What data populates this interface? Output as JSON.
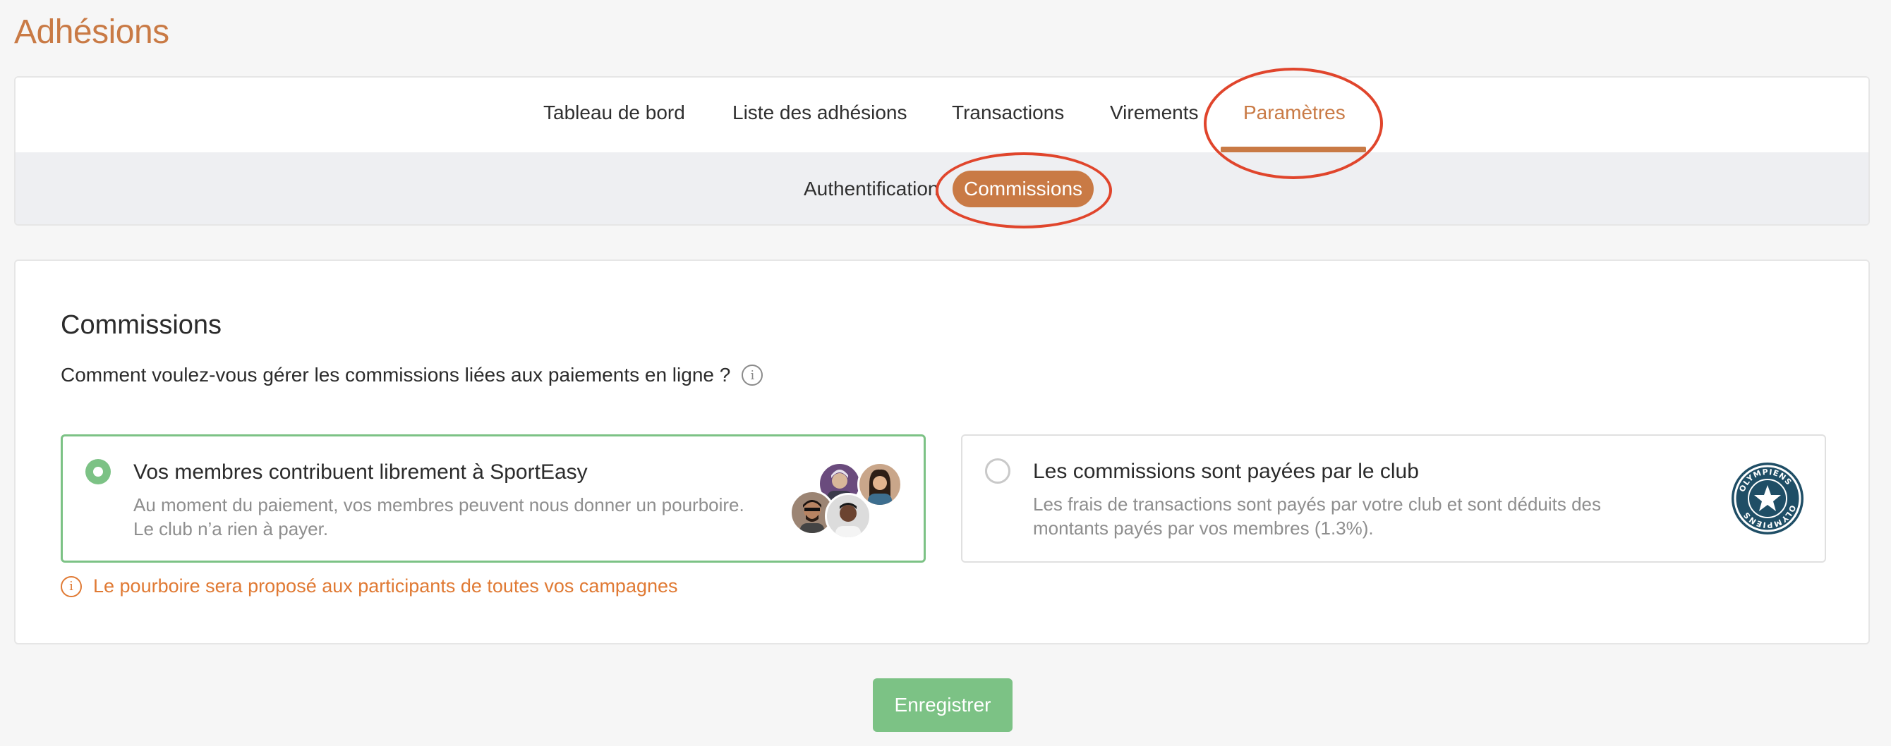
{
  "page": {
    "title": "Adhésions"
  },
  "tabs": [
    {
      "label": "Tableau de bord"
    },
    {
      "label": "Liste des adhésions"
    },
    {
      "label": "Transactions"
    },
    {
      "label": "Virements"
    },
    {
      "label": "Paramètres"
    }
  ],
  "subtabs": [
    {
      "label": "Authentification"
    },
    {
      "label": "Commissions"
    }
  ],
  "colors": {
    "accent": "#c97a45",
    "success": "#7cc285",
    "warning": "#e07a34",
    "annotation": "#e0452c"
  },
  "section": {
    "title": "Commissions",
    "question": "Comment voulez-vous gérer les commissions liées aux paiements en ligne ?",
    "info_icon": "i"
  },
  "options": [
    {
      "title": "Vos membres contribuent librement à SportEasy",
      "description": "Au moment du paiement, vos membres peuvent nous donner un pourboire. Le club n’a rien à payer.",
      "selected": true,
      "image": "member-avatars"
    },
    {
      "title": "Les commissions sont payées par le club",
      "description": "Les frais de transactions sont payés par votre club et sont déduits des montants payés par vos membres (1.3%).",
      "selected": false,
      "image": "club-logo",
      "logo_text": "OLYMPIENS"
    }
  ],
  "tip": {
    "text": "Le pourboire sera proposé aux participants de toutes vos campagnes",
    "icon": "i"
  },
  "save_button": {
    "label": "Enregistrer"
  }
}
